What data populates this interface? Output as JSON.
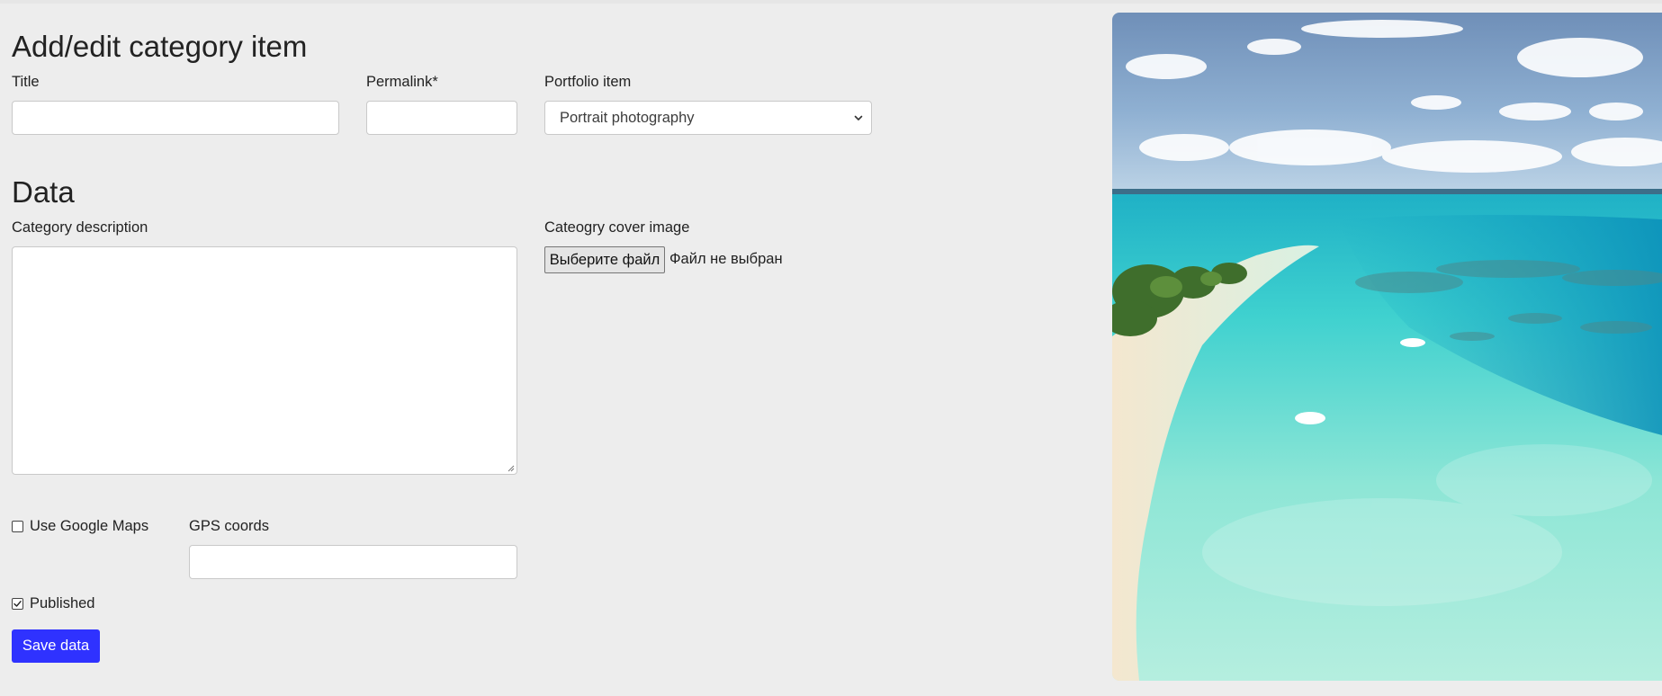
{
  "form": {
    "heading": "Add/edit category item",
    "title": {
      "label": "Title",
      "value": ""
    },
    "permalink": {
      "label": "Permalink*",
      "value": ""
    },
    "portfolio_item": {
      "label": "Portfolio item",
      "selected": "Portrait photography"
    }
  },
  "data_section": {
    "heading": "Data",
    "category_description": {
      "label": "Category description",
      "value": ""
    },
    "cover_image": {
      "label": "Cateogry cover image",
      "button_label": "Выберите файл",
      "status": "Файл не выбран"
    },
    "use_google_maps": {
      "label": "Use Google Maps",
      "checked": false
    },
    "gps_coords": {
      "label": "GPS coords",
      "value": ""
    },
    "published": {
      "label": "Published",
      "checked": true
    },
    "save_button": "Save data"
  },
  "preview": {
    "image": "tropical-lagoon-photo"
  },
  "icons": {
    "select_arrow": "chevron-down-icon",
    "checkmark": "check-icon",
    "resize": "resize-grip-icon"
  },
  "colors": {
    "page_background": "#ededed",
    "save_button": "#2f32ff",
    "input_border": "#c9c9c9"
  }
}
